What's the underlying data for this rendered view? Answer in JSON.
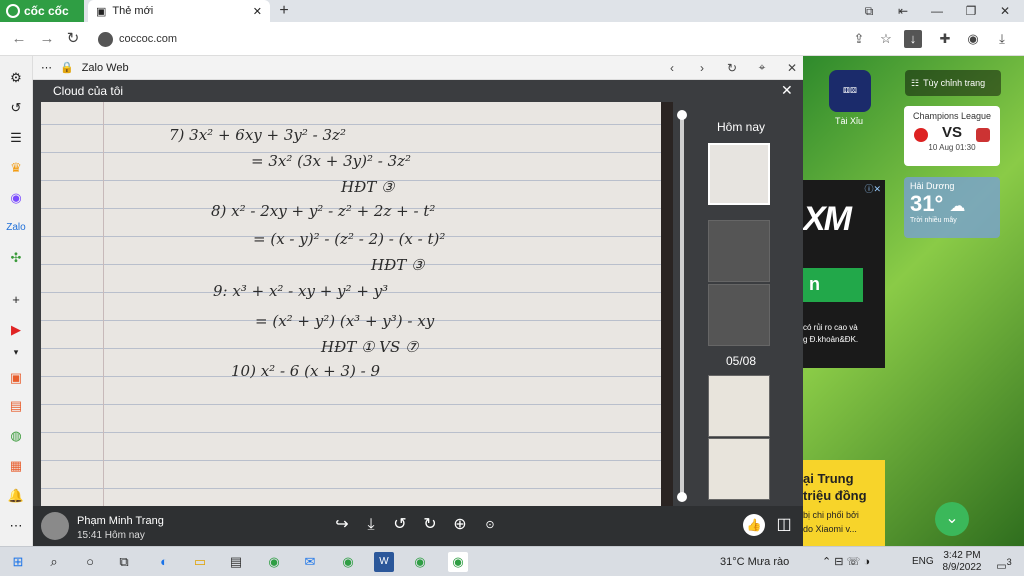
{
  "browser": {
    "brand": "cốc cốc",
    "tab_title": "Thẻ mới",
    "url": "coccoc.com"
  },
  "zalo": {
    "title": "Zalo Web",
    "viewer_title": "Cloud của tôi",
    "timeline": {
      "today_label": "Hôm nay",
      "date_label": "05/08"
    },
    "sender": {
      "name": "Phạm Minh Trang",
      "time": "15:41 Hôm nay"
    },
    "controls": [
      "share-icon",
      "download-icon",
      "rotate-left-icon",
      "rotate-right-icon",
      "zoom-in-icon",
      "actual-size-icon"
    ]
  },
  "notes": {
    "lines": [
      "7)   3x² + 6xy + 3y² - 3z²",
      "= 3x² (3x + 3y)² - 3z²",
      "HĐT ③",
      "8)  x² - 2xy + y² - z² + 2z + - t²",
      "= (x - y)² - (z² - 2) - (x - t)²",
      "HĐT ③",
      "9:  x³ + x² - xy + y² + y³",
      "= (x² + y²)   (x³ + y³) - xy",
      "HĐT ①        VS ⑦",
      "10)   x² - 6 (x + 3) - 9"
    ]
  },
  "right_panel": {
    "customize_label": "Tùy chỉnh trang",
    "game_label": "Tài Xỉu",
    "match": {
      "league": "Champions League",
      "vs": "VS",
      "date": "10 Aug 01:30"
    },
    "weather": {
      "city": "Hải Dương",
      "temp": "31°",
      "desc": "Trời nhiều mây"
    },
    "ad_top": {
      "brand": "XM",
      "green_text": "n",
      "line1": "có rủi ro cao và",
      "line2": "g Đ.khoản&ĐK."
    },
    "ad_bottom": {
      "line1": "ại Trung",
      "line2": "triệu đồng",
      "line3": "bị chi phối bởi",
      "line4": "do Xiaomi v..."
    }
  },
  "taskbar": {
    "weather": "31°C  Mưa rào",
    "lang": "ENG",
    "time": "3:42 PM",
    "date": "8/9/2022",
    "notif_count": "3"
  }
}
